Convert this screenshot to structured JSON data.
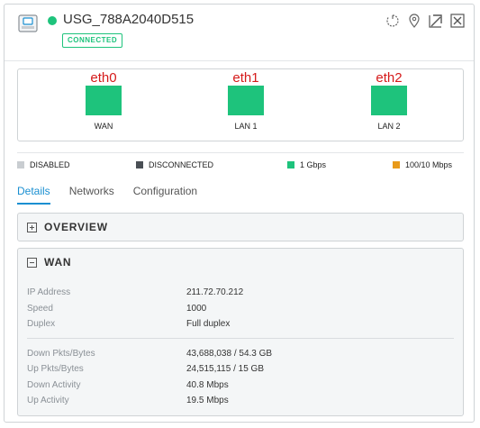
{
  "device": {
    "name": "USG_788A2040D515",
    "status": "CONNECTED",
    "status_color": "#1ec37c"
  },
  "header_icons": [
    "restart-icon",
    "locate-icon",
    "popout-icon",
    "close-icon"
  ],
  "ports": [
    {
      "iface": "eth0",
      "label": "WAN",
      "color": "#1ec37c"
    },
    {
      "iface": "eth1",
      "label": "LAN 1",
      "color": "#1ec37c"
    },
    {
      "iface": "eth2",
      "label": "LAN 2",
      "color": "#1ec37c"
    }
  ],
  "legend": [
    {
      "label": "DISABLED",
      "color": "#c9cdd1"
    },
    {
      "label": "DISCONNECTED",
      "color": "#4a4f55"
    },
    {
      "label": "1 Gbps",
      "color": "#1ec37c"
    },
    {
      "label": "100/10 Mbps",
      "color": "#e89a1a"
    }
  ],
  "tabs": [
    "Details",
    "Networks",
    "Configuration"
  ],
  "active_tab": "Details",
  "overview": {
    "title": "OVERVIEW"
  },
  "wan": {
    "title": "WAN",
    "rows1": [
      {
        "k": "IP Address",
        "v": "211.72.70.212"
      },
      {
        "k": "Speed",
        "v": "1000"
      },
      {
        "k": "Duplex",
        "v": "Full duplex"
      }
    ],
    "rows2": [
      {
        "k": "Down Pkts/Bytes",
        "v": "43,688,038 / 54.3 GB"
      },
      {
        "k": "Up Pkts/Bytes",
        "v": "24,515,115 / 15 GB"
      },
      {
        "k": "Down Activity",
        "v": "40.8 Mbps"
      },
      {
        "k": "Up Activity",
        "v": "19.5 Mbps"
      }
    ]
  }
}
